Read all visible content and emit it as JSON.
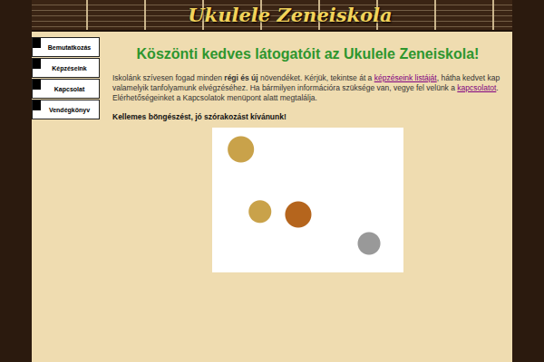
{
  "header": {
    "title": "Ukulele Zeneiskola"
  },
  "menu": {
    "items": [
      {
        "label": "Bemutatkozás"
      },
      {
        "label": "Képzéseink"
      },
      {
        "label": "Kapcsolat"
      },
      {
        "label": "Vendégkönyv"
      }
    ]
  },
  "content": {
    "heading": "Köszönti kedves látogatóit az Ukulele Zeneiskola!",
    "paragraph": [
      {
        "kind": "text",
        "text": "Iskolánk szívesen fogad minden "
      },
      {
        "kind": "bold",
        "text": "régi és új"
      },
      {
        "kind": "text",
        "text": " növendéket. Kérjük, tekintse át a "
      },
      {
        "kind": "link",
        "text": "képzéseink listáját"
      },
      {
        "kind": "text",
        "text": ", hátha kedvet kap valamelyik tanfolyamunk elvégzéséhez. Ha bármilyen információra szüksége van, vegye fel velünk a "
      },
      {
        "kind": "link",
        "text": "kapcsolatot"
      },
      {
        "kind": "text",
        "text": ". Elérhetőségeinket a Kapcsolatok menüpont alatt megtalálja."
      }
    ],
    "closing": "Kellemes böngészést, jó szórakozást kívánunk!"
  },
  "image": {
    "kind": "photo"
  }
}
